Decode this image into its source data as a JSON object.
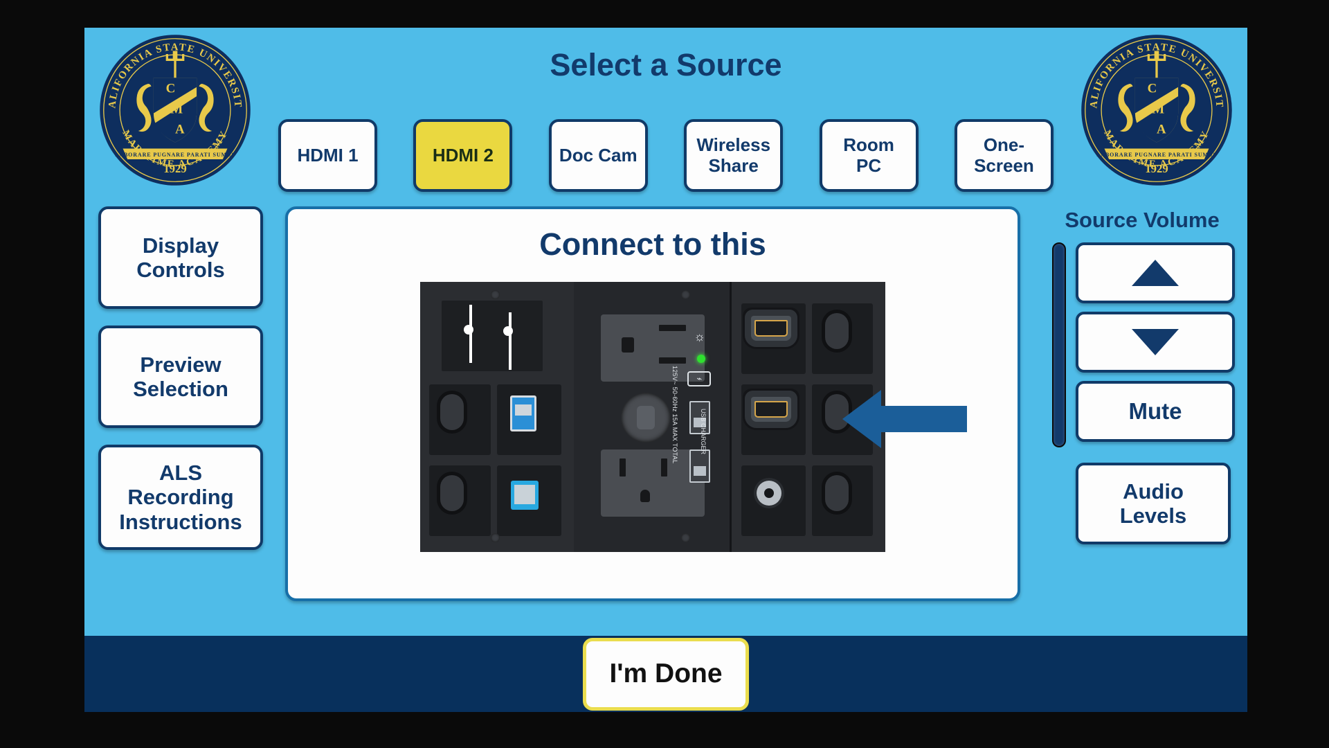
{
  "colors": {
    "panel_bg": "#4FBCE8",
    "navy": "#123A6B",
    "footer_navy": "#08305C",
    "selected_yellow": "#EAD840",
    "done_border_yellow": "#EADD4E",
    "button_white": "#FDFDFD",
    "arrow_blue": "#1B5E99",
    "letterbox": "#0A0A0A"
  },
  "header": {
    "title": "Select a Source",
    "logo_left": {
      "name": "csu-maritime-academy-seal",
      "outer_top_text": "CALIFORNIA STATE UNIVERSITY",
      "outer_bottom_text": "MARITIME ACADEMY",
      "shield_letters": [
        "C",
        "M",
        "A"
      ],
      "motto": "LABORARE PUGNARE PARATI SUMUS",
      "year": "1929"
    },
    "logo_right": {
      "name": "csu-maritime-academy-seal",
      "outer_top_text": "CALIFORNIA STATE UNIVERSITY",
      "outer_bottom_text": "MARITIME ACADEMY",
      "shield_letters": [
        "C",
        "M",
        "A"
      ],
      "motto": "LABORARE PUGNARE PARATI SUMUS",
      "year": "1929"
    }
  },
  "sources": [
    {
      "label": "HDMI 1",
      "selected": false
    },
    {
      "label": "HDMI 2",
      "selected": true
    },
    {
      "label": "Doc Cam",
      "selected": false
    },
    {
      "label": "Wireless\nShare",
      "selected": false
    },
    {
      "label": "Room\nPC",
      "selected": false
    },
    {
      "label": "One-\nScreen",
      "selected": false
    }
  ],
  "sidebar": {
    "items": [
      {
        "label": "Display\nControls"
      },
      {
        "label": "Preview\nSelection"
      },
      {
        "label": "ALS\nRecording\nInstructions"
      }
    ]
  },
  "main": {
    "title": "Connect to this",
    "plate": {
      "name": "av-wall-plate-photo",
      "description": "Black AV connection wall plate with three modules",
      "modules": [
        {
          "name": "left-module",
          "ports": [
            "audio-jack",
            "audio-jack",
            "blank",
            "usb-a",
            "blank",
            "rj45-network"
          ]
        },
        {
          "name": "center-module",
          "ports": [
            "ac-outlet",
            "round-outlet",
            "ac-outlet",
            "usb-charger",
            "usb-charger"
          ],
          "labels": [
            "125V~ 50-60Hz 15A MAX TOTAL",
            "USB CHARGER"
          ],
          "indicators": [
            "green-led",
            "sun-icon",
            "no-plug-icon"
          ]
        },
        {
          "name": "right-module",
          "ports": [
            "hdmi",
            "blank",
            "hdmi",
            "blank",
            "coax",
            "blank"
          ]
        }
      ],
      "arrow": {
        "name": "pointer-arrow",
        "direction": "left",
        "points_to": "second-hdmi-port"
      }
    }
  },
  "volume": {
    "label": "Source Volume",
    "slider_name": "volume-level-bar",
    "up_label": "▲",
    "down_label": "▼",
    "mute_label": "Mute",
    "audio_levels_label": "Audio\nLevels"
  },
  "footer": {
    "done_label": "I'm Done"
  }
}
